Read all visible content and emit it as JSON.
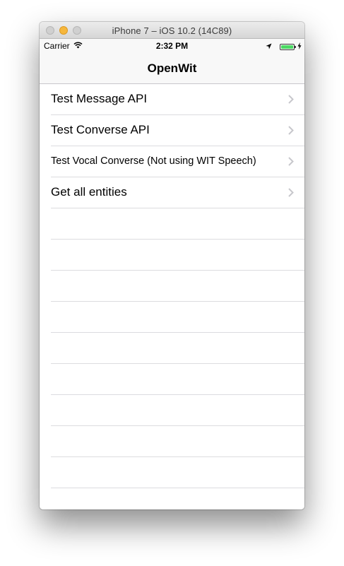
{
  "window": {
    "title": "iPhone 7 – iOS 10.2 (14C89)"
  },
  "status_bar": {
    "carrier": "Carrier",
    "time": "2:32 PM",
    "icons": [
      "wifi-icon",
      "location-icon",
      "battery-icon",
      "charging-icon"
    ],
    "battery_level": 1.0,
    "battery_color": "#4cd964"
  },
  "nav_bar": {
    "title": "OpenWit"
  },
  "table": {
    "items": [
      {
        "label": "Test Message API"
      },
      {
        "label": "Test Converse API"
      },
      {
        "label": "Test Vocal Converse (Not using WIT Speech)"
      },
      {
        "label": "Get all entities"
      }
    ]
  }
}
